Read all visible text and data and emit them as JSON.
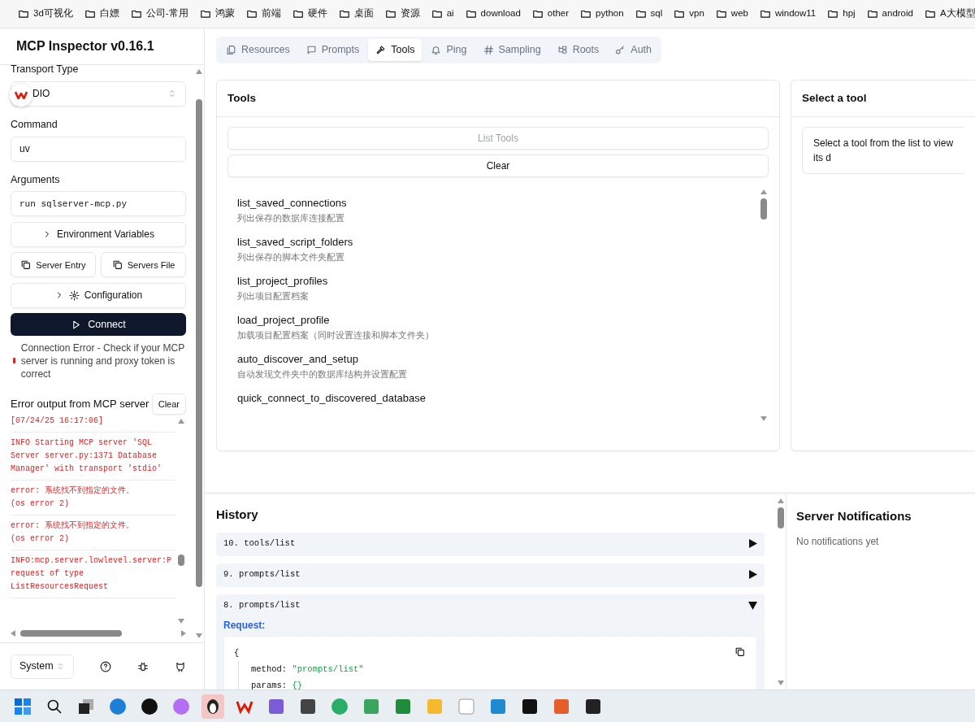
{
  "bookmarks": [
    {
      "label": "3d可视化"
    },
    {
      "label": "白嫖"
    },
    {
      "label": "公司-常用"
    },
    {
      "label": "鸿蒙"
    },
    {
      "label": "前端"
    },
    {
      "label": "硬件"
    },
    {
      "label": "桌面"
    },
    {
      "label": "资源"
    },
    {
      "label": "ai"
    },
    {
      "label": "download"
    },
    {
      "label": "other"
    },
    {
      "label": "python"
    },
    {
      "label": "sql"
    },
    {
      "label": "vpn"
    },
    {
      "label": "web"
    },
    {
      "label": "window11"
    },
    {
      "label": "hpj"
    },
    {
      "label": "android"
    },
    {
      "label": "A大模型"
    }
  ],
  "sidebar": {
    "title": "MCP Inspector v0.16.1",
    "transport_label": "Transport Type",
    "transport_value": "DIO",
    "command_label": "Command",
    "command_value": "uv",
    "arguments_label": "Arguments",
    "arguments_value": "run sqlserver-mcp.py",
    "env_button": "Environment Variables",
    "server_entry_button": "Server Entry",
    "servers_file_button": "Servers File",
    "config_button": "Configuration",
    "connect_button": "Connect",
    "connection_error": "Connection Error - Check if your MCP server is running and proxy token is correct",
    "error_output": {
      "title": "Error output from MCP server",
      "clear_button": "Clear",
      "entries": [
        {
          "lines": [
            "[07/24/25 16:17:06]"
          ]
        },
        {
          "lines": [
            "INFO Starting MCP server 'SQL",
            "Server server.py:1371 Database",
            "Manager' with transport 'stdio'"
          ]
        },
        {
          "lines": [
            "error: 系统找不到指定的文件。",
            "(os error 2)"
          ]
        },
        {
          "lines": [
            "error: 系统找不到指定的文件。",
            "(os error 2)"
          ]
        },
        {
          "lines": [
            "INFO:mcp.server.lowlevel.server:P",
            "request of type",
            "ListResourcesRequest"
          ]
        }
      ]
    },
    "theme": "System"
  },
  "tabs": [
    {
      "label": "Resources",
      "selected": false
    },
    {
      "label": "Prompts",
      "selected": false
    },
    {
      "label": "Tools",
      "selected": true
    },
    {
      "label": "Ping",
      "selected": false
    },
    {
      "label": "Sampling",
      "selected": false
    },
    {
      "label": "Roots",
      "selected": false
    },
    {
      "label": "Auth",
      "selected": false
    }
  ],
  "tools_panel": {
    "title": "Tools",
    "list_button": "List Tools",
    "list_disabled": true,
    "clear_button": "Clear",
    "tools": [
      {
        "name": "list_saved_connections",
        "description": "列出保存的数据库连接配置"
      },
      {
        "name": "list_saved_script_folders",
        "description": "列出保存的脚本文件夹配置"
      },
      {
        "name": "list_project_profiles",
        "description": "列出项目配置档案"
      },
      {
        "name": "load_project_profile",
        "description": "加载项目配置档案（同时设置连接和脚本文件夹）"
      },
      {
        "name": "auto_discover_and_setup",
        "description": "自动发现文件夹中的数据库结构并设置配置"
      },
      {
        "name": "quick_connect_to_discovered_database"
      }
    ]
  },
  "detail_panel": {
    "title": "Select a tool",
    "message": "Select a tool from the list to view its d"
  },
  "history": {
    "title": "History",
    "entries": [
      {
        "label": "10. tools/list",
        "expanded": false
      },
      {
        "label": "9. prompts/list",
        "expanded": false
      },
      {
        "label": "8. prompts/list",
        "expanded": true,
        "request_label": "Request:",
        "open_brace": "{",
        "fields": [
          {
            "key": "method:",
            "value": "\"prompts/list\""
          },
          {
            "key": "params:",
            "value": "{}"
          }
        ]
      }
    ]
  },
  "notifications": {
    "title": "Server Notifications",
    "message": "No notifications yet"
  }
}
